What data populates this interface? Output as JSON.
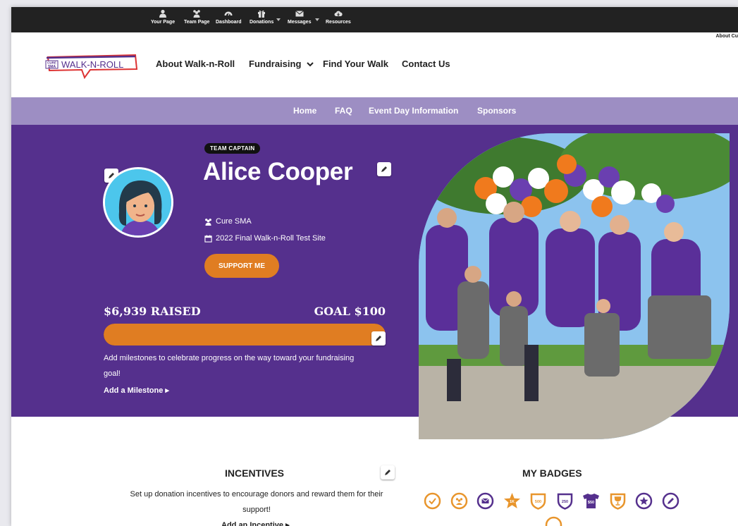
{
  "topbar": {
    "items": [
      {
        "label": "Your Page",
        "icon": "user-icon"
      },
      {
        "label": "Team Page",
        "icon": "team-icon"
      },
      {
        "label": "Dashboard",
        "icon": "dashboard-icon"
      },
      {
        "label": "Donations",
        "icon": "gift-icon"
      },
      {
        "label": "Messages",
        "icon": "envelope-icon"
      },
      {
        "label": "Resources",
        "icon": "cloud-icon"
      }
    ],
    "right_cut_text": "About Cu"
  },
  "header": {
    "logo_text": "WALK-N-ROLL",
    "logo_badge": "CURE SMA",
    "nav": [
      "About Walk-n-Roll",
      "Fundraising",
      "Find Your Walk",
      "Contact Us"
    ]
  },
  "subnav": [
    "Home",
    "FAQ",
    "Event Day Information",
    "Sponsors"
  ],
  "profile": {
    "role_badge": "TEAM CAPTAIN",
    "name": "Alice Cooper",
    "organization": "Cure SMA",
    "event": "2022 Final Walk-n-Roll Test Site",
    "support_button": "SUPPORT ME"
  },
  "fundraising": {
    "raised_text": "$6,939 RAISED",
    "goal_text": "GOAL $100",
    "progress_fraction": 1.0,
    "milestone_prompt": "Add milestones to celebrate progress on the way toward your fundraising goal!",
    "milestone_link": "Add a Milestone ▸"
  },
  "incentives": {
    "title": "INCENTIVES",
    "text": "Set up donation incentives to encourage donors and reward them for their support!",
    "link": "Add an Incentive ▸"
  },
  "badges": {
    "title": "MY BADGES",
    "items": [
      {
        "icon": "check-badge-icon",
        "label": ""
      },
      {
        "icon": "team-badge-icon",
        "label": ""
      },
      {
        "icon": "envelope-badge-icon",
        "label": ""
      },
      {
        "icon": "star-1k-badge-icon",
        "label": "1K"
      },
      {
        "icon": "shield-500-badge-icon",
        "label": "500"
      },
      {
        "icon": "shield-250-badge-icon",
        "label": "250"
      },
      {
        "icon": "shirt-50-badge-icon",
        "label": "$50"
      },
      {
        "icon": "trophy-badge-icon",
        "label": ""
      },
      {
        "icon": "star-circle-badge-icon",
        "label": ""
      },
      {
        "icon": "pencil-badge-icon",
        "label": ""
      }
    ]
  },
  "colors": {
    "primary_purple": "#55308d",
    "subnav_purple": "#9d8ec3",
    "accent_orange": "#e07d22",
    "topbar": "#222222"
  }
}
